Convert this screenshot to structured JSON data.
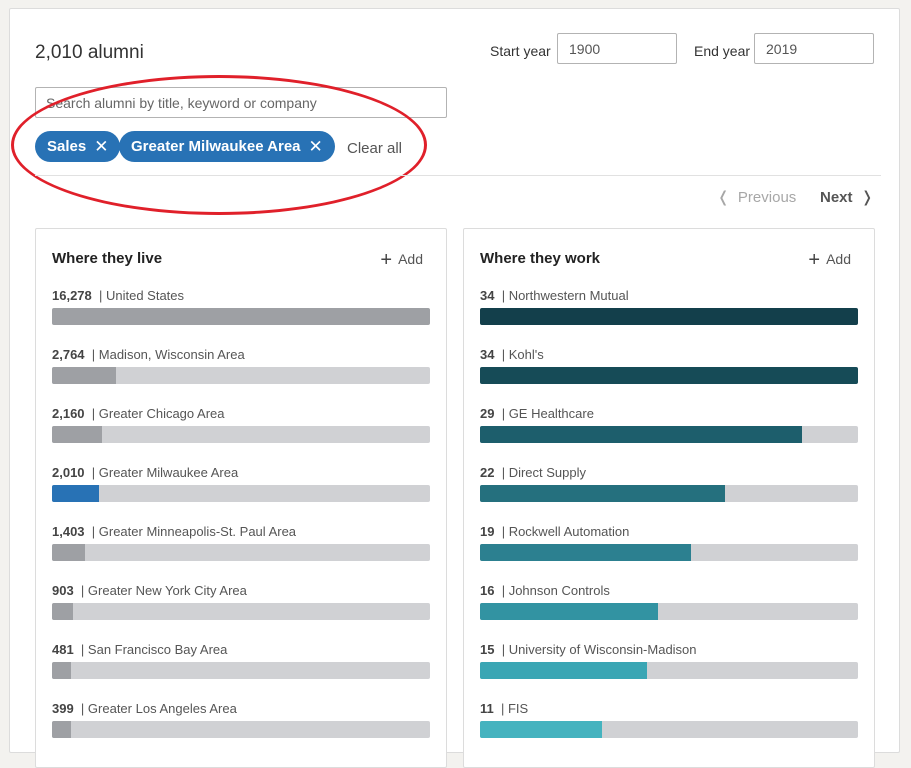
{
  "header": {
    "alumni_count": "2,010 alumni",
    "start_year_label": "Start year",
    "start_year_value": "1900",
    "end_year_label": "End year",
    "end_year_value": "2019"
  },
  "search": {
    "placeholder": "Search alumni by title, keyword or company",
    "value": ""
  },
  "filters": {
    "pills": [
      {
        "label": "Sales",
        "close_icon": "close-icon"
      },
      {
        "label": "Greater Milwaukee Area",
        "close_icon": "close-icon"
      }
    ],
    "clear_all_label": "Clear all"
  },
  "pager": {
    "previous_label": "Previous",
    "next_label": "Next"
  },
  "colors": {
    "accent": "#2872b5",
    "highlight_oval": "#e0202a",
    "bar_gray": "#9ea0a4",
    "bar_track": "#d0d1d4"
  },
  "where_they_live": {
    "title": "Where they live",
    "add_label": "Add",
    "items": [
      {
        "count": "16,278",
        "label": "United States",
        "fraction": 1.0,
        "color": "#9ea0a4"
      },
      {
        "count": "2,764",
        "label": "Madison, Wisconsin Area",
        "fraction": 0.17,
        "color": "#9ea0a4"
      },
      {
        "count": "2,160",
        "label": "Greater Chicago Area",
        "fraction": 0.133,
        "color": "#9ea0a4"
      },
      {
        "count": "2,010",
        "label": "Greater Milwaukee Area",
        "fraction": 0.124,
        "color": "#2872b5"
      },
      {
        "count": "1,403",
        "label": "Greater Minneapolis-St. Paul Area",
        "fraction": 0.086,
        "color": "#9ea0a4"
      },
      {
        "count": "903",
        "label": "Greater New York City Area",
        "fraction": 0.055,
        "color": "#9ea0a4"
      },
      {
        "count": "481",
        "label": "San Francisco Bay Area",
        "fraction": 0.05,
        "color": "#9ea0a4"
      },
      {
        "count": "399",
        "label": "Greater Los Angeles Area",
        "fraction": 0.05,
        "color": "#9ea0a4"
      }
    ]
  },
  "where_they_work": {
    "title": "Where they work",
    "add_label": "Add",
    "items": [
      {
        "count": "34",
        "label": "Northwestern Mutual",
        "fraction": 1.0,
        "color": "#133f4b"
      },
      {
        "count": "34",
        "label": "Kohl's",
        "fraction": 1.0,
        "color": "#164b57"
      },
      {
        "count": "29",
        "label": "GE Healthcare",
        "fraction": 0.853,
        "color": "#1d5e6c"
      },
      {
        "count": "22",
        "label": "Direct Supply",
        "fraction": 0.647,
        "color": "#25707e"
      },
      {
        "count": "19",
        "label": "Rockwell Automation",
        "fraction": 0.559,
        "color": "#2c8090"
      },
      {
        "count": "16",
        "label": "Johnson Controls",
        "fraction": 0.471,
        "color": "#3293a2"
      },
      {
        "count": "15",
        "label": "University of Wisconsin-Madison",
        "fraction": 0.441,
        "color": "#3aa6b4"
      },
      {
        "count": "11",
        "label": "FIS",
        "fraction": 0.324,
        "color": "#45b3bf"
      }
    ]
  }
}
